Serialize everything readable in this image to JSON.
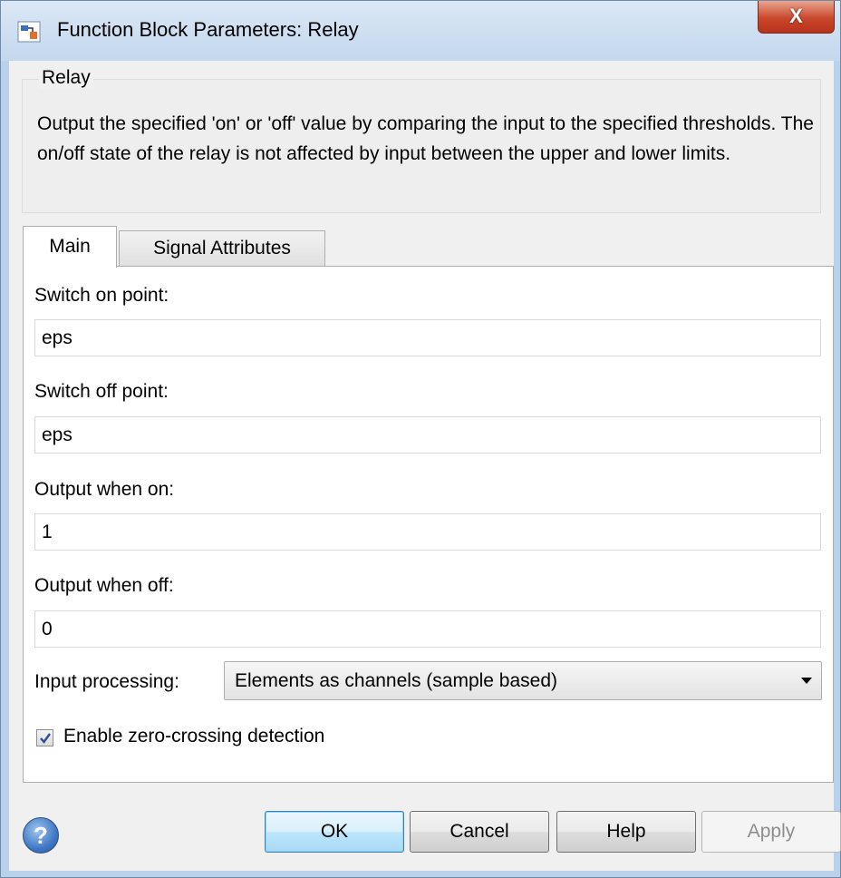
{
  "window": {
    "title": "Function Block Parameters: Relay",
    "close_label": "X"
  },
  "description": {
    "legend": "Relay",
    "text": "Output the specified 'on' or 'off' value by comparing the input to the specified thresholds.  The on/off state of the relay is not affected by input between the upper and lower limits."
  },
  "tabs": [
    {
      "label": "Main",
      "selected": true
    },
    {
      "label": "Signal Attributes",
      "selected": false
    }
  ],
  "fields": {
    "switch_on": {
      "label": "Switch on point:",
      "value": "eps"
    },
    "switch_off": {
      "label": "Switch off point:",
      "value": "eps"
    },
    "output_on": {
      "label": "Output when on:",
      "value": "1"
    },
    "output_off": {
      "label": "Output when off:",
      "value": "0"
    }
  },
  "input_processing": {
    "label": "Input processing:",
    "selected": "Elements as channels (sample based)"
  },
  "zero_crossing": {
    "label": "Enable zero-crossing detection",
    "checked": true
  },
  "buttons": {
    "ok": "OK",
    "cancel": "Cancel",
    "help": "Help",
    "apply": "Apply"
  },
  "help_icon_glyph": "?",
  "colors": {
    "close_button": "#c8472b",
    "ok_button_border": "#3c7fb1",
    "checkbox_check": "#2a4d9e"
  }
}
